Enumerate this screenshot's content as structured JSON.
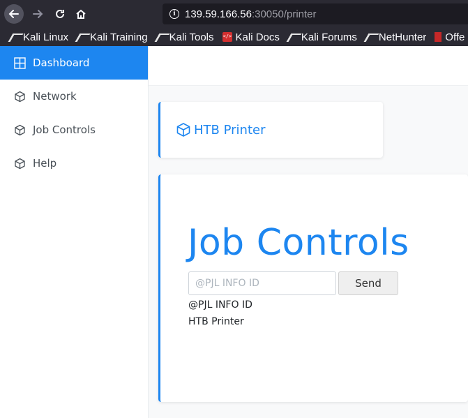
{
  "browser": {
    "url_host": "139.59.166.56",
    "url_rest": ":30050/printer",
    "bookmarks": [
      {
        "label": "Kali Linux",
        "icon": "kali-dragon-icon"
      },
      {
        "label": "Kali Training",
        "icon": "kali-dragon-icon"
      },
      {
        "label": "Kali Tools",
        "icon": "kali-dragon-icon"
      },
      {
        "label": "Kali Docs",
        "icon": "docs-icon"
      },
      {
        "label": "Kali Forums",
        "icon": "kali-dragon-icon"
      },
      {
        "label": "NetHunter",
        "icon": "kali-dragon-icon"
      },
      {
        "label": "Offe",
        "icon": "offsec-icon"
      }
    ]
  },
  "sidebar": {
    "items": [
      {
        "label": "Dashboard",
        "icon": "grid-icon",
        "active": true
      },
      {
        "label": "Network",
        "icon": "box-icon"
      },
      {
        "label": "Job Controls",
        "icon": "box-icon"
      },
      {
        "label": "Help",
        "icon": "box-icon"
      }
    ]
  },
  "header_card": {
    "title": "HTB Printer",
    "icon": "box-icon"
  },
  "main": {
    "title": "Job Controls",
    "input_placeholder": "@PJL INFO ID",
    "input_value": "",
    "send_label": "Send",
    "output": [
      "@PJL INFO ID",
      "HTB Printer"
    ]
  },
  "colors": {
    "accent": "#1d86f0",
    "chrome_bg": "#2b2a33"
  }
}
